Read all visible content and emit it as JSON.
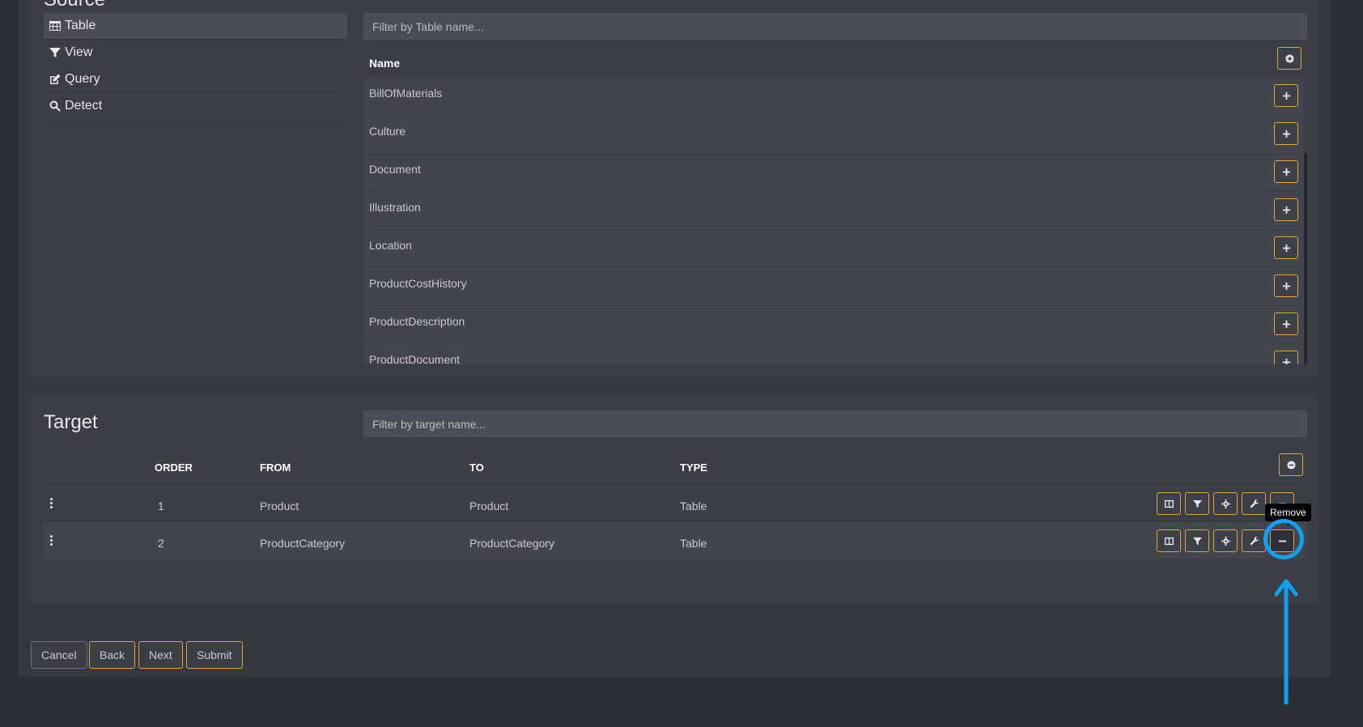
{
  "source": {
    "title": "Source",
    "menu": [
      {
        "label": "Table",
        "icon": "table-icon",
        "active": true
      },
      {
        "label": "View",
        "icon": "filter-icon",
        "active": false
      },
      {
        "label": "Query",
        "icon": "edit-icon",
        "active": false
      },
      {
        "label": "Detect",
        "icon": "search-icon",
        "active": false
      }
    ],
    "filter_placeholder": "Filter by Table name...",
    "column_header": "Name",
    "rows": [
      "BillOfMaterials",
      "Culture",
      "Document",
      "Illustration",
      "Location",
      "ProductCostHistory",
      "ProductDescription",
      "ProductDocument"
    ]
  },
  "target": {
    "title": "Target",
    "filter_placeholder": "Filter by target name...",
    "headers": {
      "order": "ORDER",
      "from": "FROM",
      "to": "TO",
      "type": "TYPE"
    },
    "rows": [
      {
        "order": "1",
        "from": "Product",
        "to": "Product",
        "type": "Table"
      },
      {
        "order": "2",
        "from": "ProductCategory",
        "to": "ProductCategory",
        "type": "Table"
      }
    ]
  },
  "tooltip": "Remove",
  "footer": {
    "cancel": "Cancel",
    "back": "Back",
    "next": "Next",
    "submit": "Submit"
  },
  "colors": {
    "accent": "#e0a53a",
    "highlight": "#0ea1f0",
    "background": "#2c2e35"
  }
}
